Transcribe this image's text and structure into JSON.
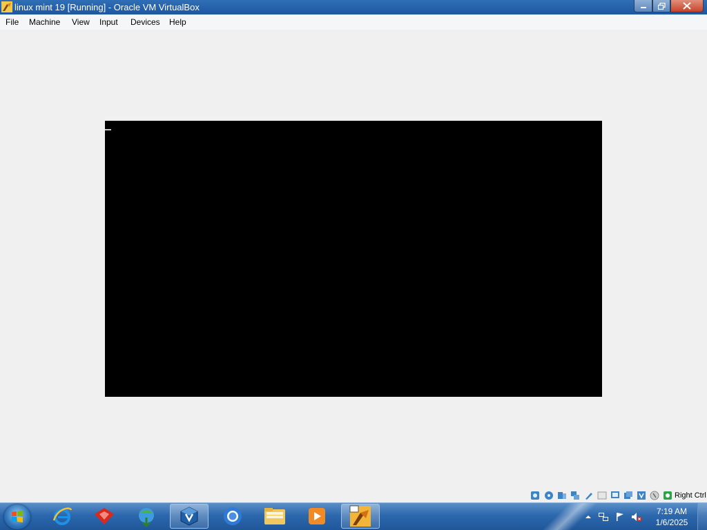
{
  "window": {
    "title": "linux mint 19 [Running] - Oracle VM VirtualBox"
  },
  "menu": [
    "File",
    "Machine",
    "View",
    "Input",
    "Devices",
    "Help"
  ],
  "statusbar": {
    "icons": [
      "hard-disk-icon",
      "optical-drive-icon",
      "audio-icon",
      "network-icon",
      "usb-icon",
      "shared-folders-icon",
      "display-icon",
      "video-capture-icon",
      "cpu-icon",
      "mouse-integration-icon",
      "keyboard-icon"
    ],
    "host_key": "Right Ctrl"
  },
  "taskbar": {
    "apps": [
      "internet-explorer-icon",
      "red-app-icon",
      "download-manager-icon",
      "virtualbox-icon",
      "chrome-icon",
      "file-explorer-icon",
      "media-player-icon",
      "virtualbox-vm-icon"
    ],
    "active_app": "virtualbox-vm-icon",
    "clock_time": "7:19 AM",
    "clock_date": "1/6/2025"
  }
}
